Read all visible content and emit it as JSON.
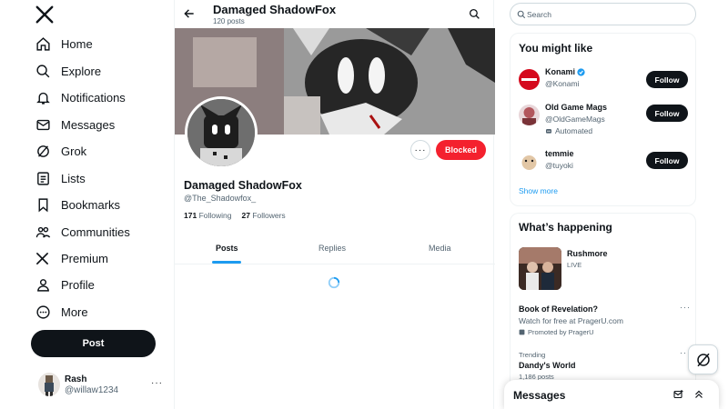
{
  "nav": {
    "items": [
      {
        "label": "Home",
        "icon": "home-icon"
      },
      {
        "label": "Explore",
        "icon": "search-icon"
      },
      {
        "label": "Notifications",
        "icon": "bell-icon"
      },
      {
        "label": "Messages",
        "icon": "mail-icon"
      },
      {
        "label": "Grok",
        "icon": "grok-icon"
      },
      {
        "label": "Lists",
        "icon": "list-icon"
      },
      {
        "label": "Bookmarks",
        "icon": "bookmark-icon"
      },
      {
        "label": "Communities",
        "icon": "communities-icon"
      },
      {
        "label": "Premium",
        "icon": "x-logo-icon"
      },
      {
        "label": "Profile",
        "icon": "person-icon"
      },
      {
        "label": "More",
        "icon": "more-circle-icon"
      }
    ],
    "post_label": "Post"
  },
  "account": {
    "name": "Rash",
    "handle": "@willaw1234",
    "more": "···"
  },
  "profile": {
    "title": "Damaged ShadowFox",
    "post_count": "120 posts",
    "name": "Damaged ShadowFox",
    "handle": "@The_Shadowfox_",
    "following_count": "171",
    "following_label": "Following",
    "followers_count": "27",
    "followers_label": "Followers",
    "blocked_label": "Blocked",
    "more_label": "···"
  },
  "tabs": [
    "Posts",
    "Replies",
    "Media"
  ],
  "search": {
    "placeholder": "Search"
  },
  "who_to_follow": {
    "title": "You might like",
    "users": [
      {
        "name": "Konami",
        "handle": "@Konami",
        "verified": true
      },
      {
        "name": "Old Game Mags",
        "handle": "@OldGameMags",
        "automated": "Automated"
      },
      {
        "name": "temmie",
        "handle": "@tuyoki"
      }
    ],
    "follow_label": "Follow",
    "show_more": "Show more"
  },
  "whats_happening": {
    "title": "What’s happening",
    "event": {
      "name": "Rushmore",
      "status": "LIVE"
    },
    "promo": {
      "title": "Book of Revelation?",
      "line": "Watch for free at PragerU.com",
      "by": "Promoted by PragerU"
    },
    "trend": {
      "context": "Trending",
      "name": "Dandy's World",
      "count": "1,186 posts"
    }
  },
  "messages_drawer": {
    "title": "Messages"
  },
  "colors": {
    "accent": "#1d9bf0",
    "blocked": "#f4212e",
    "text": "#0f1419",
    "muted": "#536471"
  }
}
